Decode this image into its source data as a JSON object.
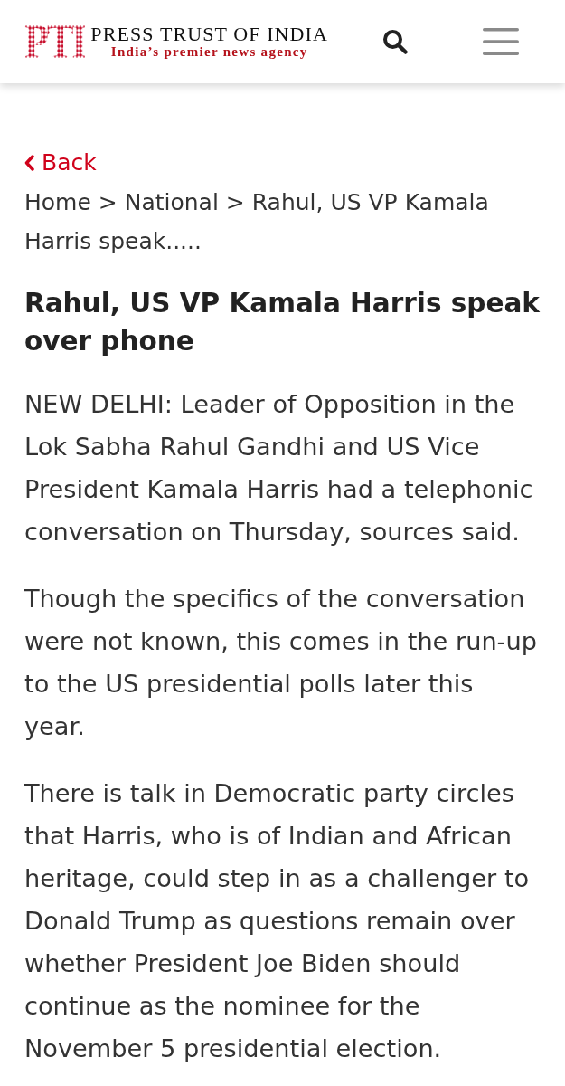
{
  "header": {
    "logo": {
      "mark": "PTI",
      "name": "PRESS TRUST OF INDIA",
      "tagline": "India’s premier news agency"
    }
  },
  "back_link": {
    "label": "Back"
  },
  "breadcrumb": {
    "links": [
      "Home",
      "National"
    ],
    "separators": [
      ">",
      ">"
    ],
    "current": "Rahul, US VP Kamala Harris speak....."
  },
  "article": {
    "headline": "Rahul, US VP Kamala Harris speak over phone",
    "paragraphs": [
      "NEW DELHI: Leader of Opposition in the Lok Sabha Rahul Gandhi and US Vice President Kamala Harris had a telephonic conversation on Thursday, sources said.",
      "Though the specifics of the conversation were not known, this comes in the run-up to the US presidential polls later this year.",
      "There is talk in Democratic party circles that Harris, who is of Indian and African heritage, could step in as a challenger to Donald Trump as questions remain over whether President Joe Biden should continue as the nominee for the November 5 presidential election."
    ]
  }
}
